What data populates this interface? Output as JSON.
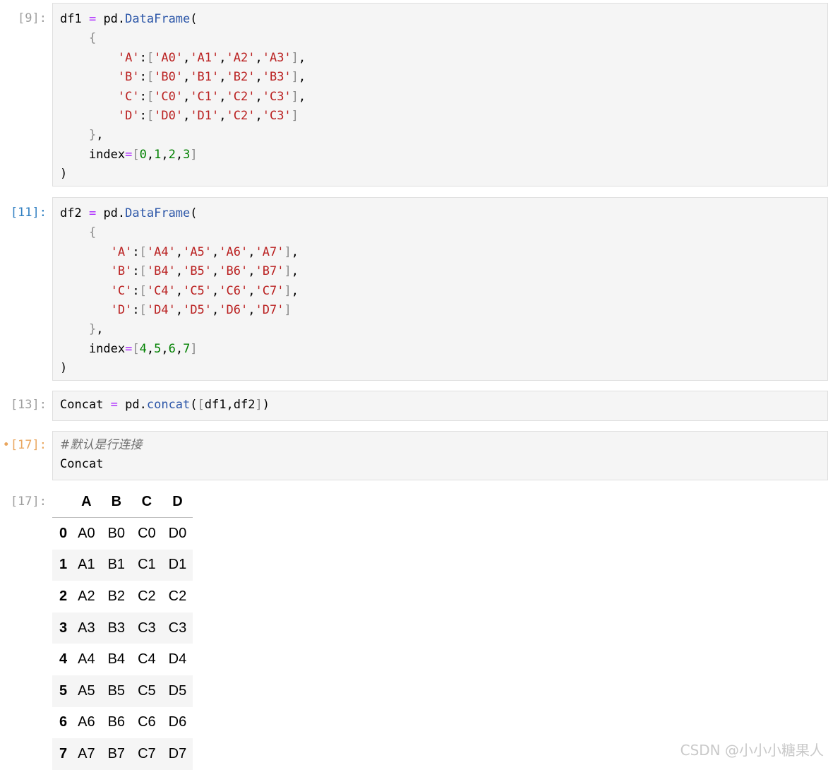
{
  "cells": [
    {
      "prompt": "[9]:",
      "lines": [
        [
          [
            "df1 ",
            "kw"
          ],
          [
            "=",
            "op"
          ],
          [
            " pd.",
            "kw"
          ],
          [
            "DataFrame",
            "attr"
          ],
          [
            "(",
            "pun"
          ]
        ],
        [
          [
            "    ",
            "kw"
          ],
          [
            "{",
            "br"
          ]
        ],
        [
          [
            "        ",
            "kw"
          ],
          [
            "'A'",
            "str"
          ],
          [
            ":",
            "pun"
          ],
          [
            "[",
            "br"
          ],
          [
            "'A0'",
            "str"
          ],
          [
            ",",
            "pun"
          ],
          [
            "'A1'",
            "str"
          ],
          [
            ",",
            "pun"
          ],
          [
            "'A2'",
            "str"
          ],
          [
            ",",
            "pun"
          ],
          [
            "'A3'",
            "str"
          ],
          [
            "]",
            "br"
          ],
          [
            ",",
            "pun"
          ]
        ],
        [
          [
            "        ",
            "kw"
          ],
          [
            "'B'",
            "str"
          ],
          [
            ":",
            "pun"
          ],
          [
            "[",
            "br"
          ],
          [
            "'B0'",
            "str"
          ],
          [
            ",",
            "pun"
          ],
          [
            "'B1'",
            "str"
          ],
          [
            ",",
            "pun"
          ],
          [
            "'B2'",
            "str"
          ],
          [
            ",",
            "pun"
          ],
          [
            "'B3'",
            "str"
          ],
          [
            "]",
            "br"
          ],
          [
            ",",
            "pun"
          ]
        ],
        [
          [
            "        ",
            "kw"
          ],
          [
            "'C'",
            "str"
          ],
          [
            ":",
            "pun"
          ],
          [
            "[",
            "br"
          ],
          [
            "'C0'",
            "str"
          ],
          [
            ",",
            "pun"
          ],
          [
            "'C1'",
            "str"
          ],
          [
            ",",
            "pun"
          ],
          [
            "'C2'",
            "str"
          ],
          [
            ",",
            "pun"
          ],
          [
            "'C3'",
            "str"
          ],
          [
            "]",
            "br"
          ],
          [
            ",",
            "pun"
          ]
        ],
        [
          [
            "        ",
            "kw"
          ],
          [
            "'D'",
            "str"
          ],
          [
            ":",
            "pun"
          ],
          [
            "[",
            "br"
          ],
          [
            "'D0'",
            "str"
          ],
          [
            ",",
            "pun"
          ],
          [
            "'D1'",
            "str"
          ],
          [
            ",",
            "pun"
          ],
          [
            "'C2'",
            "str"
          ],
          [
            ",",
            "pun"
          ],
          [
            "'C3'",
            "str"
          ],
          [
            "]",
            "br"
          ]
        ],
        [
          [
            "    ",
            "kw"
          ],
          [
            "}",
            "br"
          ],
          [
            ",",
            "pun"
          ]
        ],
        [
          [
            "    index",
            "kw"
          ],
          [
            "=",
            "op"
          ],
          [
            "[",
            "br"
          ],
          [
            "0",
            "num"
          ],
          [
            ",",
            "pun"
          ],
          [
            "1",
            "num"
          ],
          [
            ",",
            "pun"
          ],
          [
            "2",
            "num"
          ],
          [
            ",",
            "pun"
          ],
          [
            "3",
            "num"
          ],
          [
            "]",
            "br"
          ]
        ],
        [
          [
            ")",
            "pun"
          ]
        ]
      ]
    },
    {
      "prompt": "[11]:",
      "lines": [
        [
          [
            "df2 ",
            "kw"
          ],
          [
            "=",
            "op"
          ],
          [
            " pd.",
            "kw"
          ],
          [
            "DataFrame",
            "attr"
          ],
          [
            "(",
            "pun"
          ]
        ],
        [
          [
            "    ",
            "kw"
          ],
          [
            "{",
            "br"
          ]
        ],
        [
          [
            "       ",
            "kw"
          ],
          [
            "'A'",
            "str"
          ],
          [
            ":",
            "pun"
          ],
          [
            "[",
            "br"
          ],
          [
            "'A4'",
            "str"
          ],
          [
            ",",
            "pun"
          ],
          [
            "'A5'",
            "str"
          ],
          [
            ",",
            "pun"
          ],
          [
            "'A6'",
            "str"
          ],
          [
            ",",
            "pun"
          ],
          [
            "'A7'",
            "str"
          ],
          [
            "]",
            "br"
          ],
          [
            ",",
            "pun"
          ]
        ],
        [
          [
            "       ",
            "kw"
          ],
          [
            "'B'",
            "str"
          ],
          [
            ":",
            "pun"
          ],
          [
            "[",
            "br"
          ],
          [
            "'B4'",
            "str"
          ],
          [
            ",",
            "pun"
          ],
          [
            "'B5'",
            "str"
          ],
          [
            ",",
            "pun"
          ],
          [
            "'B6'",
            "str"
          ],
          [
            ",",
            "pun"
          ],
          [
            "'B7'",
            "str"
          ],
          [
            "]",
            "br"
          ],
          [
            ",",
            "pun"
          ]
        ],
        [
          [
            "       ",
            "kw"
          ],
          [
            "'C'",
            "str"
          ],
          [
            ":",
            "pun"
          ],
          [
            "[",
            "br"
          ],
          [
            "'C4'",
            "str"
          ],
          [
            ",",
            "pun"
          ],
          [
            "'C5'",
            "str"
          ],
          [
            ",",
            "pun"
          ],
          [
            "'C6'",
            "str"
          ],
          [
            ",",
            "pun"
          ],
          [
            "'C7'",
            "str"
          ],
          [
            "]",
            "br"
          ],
          [
            ",",
            "pun"
          ]
        ],
        [
          [
            "       ",
            "kw"
          ],
          [
            "'D'",
            "str"
          ],
          [
            ":",
            "pun"
          ],
          [
            "[",
            "br"
          ],
          [
            "'D4'",
            "str"
          ],
          [
            ",",
            "pun"
          ],
          [
            "'D5'",
            "str"
          ],
          [
            ",",
            "pun"
          ],
          [
            "'D6'",
            "str"
          ],
          [
            ",",
            "pun"
          ],
          [
            "'D7'",
            "str"
          ],
          [
            "]",
            "br"
          ]
        ],
        [
          [
            "    ",
            "kw"
          ],
          [
            "}",
            "br"
          ],
          [
            ",",
            "pun"
          ]
        ],
        [
          [
            "    index",
            "kw"
          ],
          [
            "=",
            "op"
          ],
          [
            "[",
            "br"
          ],
          [
            "4",
            "num"
          ],
          [
            ",",
            "pun"
          ],
          [
            "5",
            "num"
          ],
          [
            ",",
            "pun"
          ],
          [
            "6",
            "num"
          ],
          [
            ",",
            "pun"
          ],
          [
            "7",
            "num"
          ],
          [
            "]",
            "br"
          ]
        ],
        [
          [
            ")",
            "pun"
          ]
        ]
      ]
    },
    {
      "prompt": "[13]:",
      "lines": [
        [
          [
            "Concat ",
            "kw"
          ],
          [
            "=",
            "op"
          ],
          [
            " pd.",
            "kw"
          ],
          [
            "concat",
            "attr"
          ],
          [
            "(",
            "pun"
          ],
          [
            "[",
            "br"
          ],
          [
            "df1,df2",
            "kw"
          ],
          [
            "]",
            "br"
          ],
          [
            ")",
            "pun"
          ]
        ]
      ]
    },
    {
      "prompt": "[17]:",
      "modified_marker": "•",
      "lines": [
        [
          [
            "#默认是行连接",
            "cm"
          ]
        ],
        [
          [
            "Concat",
            "kw"
          ]
        ]
      ]
    }
  ],
  "output": {
    "prompt": "[17]:",
    "columns": [
      "A",
      "B",
      "C",
      "D"
    ],
    "rows": [
      {
        "index": "0",
        "values": [
          "A0",
          "B0",
          "C0",
          "D0"
        ]
      },
      {
        "index": "1",
        "values": [
          "A1",
          "B1",
          "C1",
          "D1"
        ]
      },
      {
        "index": "2",
        "values": [
          "A2",
          "B2",
          "C2",
          "C2"
        ]
      },
      {
        "index": "3",
        "values": [
          "A3",
          "B3",
          "C3",
          "C3"
        ]
      },
      {
        "index": "4",
        "values": [
          "A4",
          "B4",
          "C4",
          "D4"
        ]
      },
      {
        "index": "5",
        "values": [
          "A5",
          "B5",
          "C5",
          "D5"
        ]
      },
      {
        "index": "6",
        "values": [
          "A6",
          "B6",
          "C6",
          "D6"
        ]
      },
      {
        "index": "7",
        "values": [
          "A7",
          "B7",
          "C7",
          "D7"
        ]
      }
    ]
  },
  "watermark": "CSDN @小小小糖果人"
}
